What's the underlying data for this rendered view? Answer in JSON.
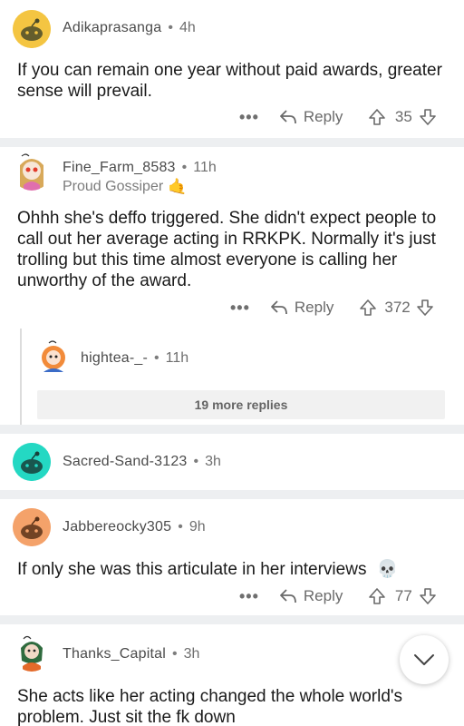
{
  "comments": [
    {
      "user": "Adikaprasanga",
      "time": "4h",
      "body": "If you can remain one year without paid awards, greater sense will prevail.",
      "reply_label": "Reply",
      "score": "35",
      "more_label": "•••"
    },
    {
      "user": "Fine_Farm_8583",
      "time": "11h",
      "flair": "Proud Gossiper",
      "flair_emoji": "🤙",
      "body": "Ohhh she's deffo triggered. She didn't expect people to call out her average acting in RRKPK. Normally it's just trolling but this time almost everyone is calling her unworthy of the award.",
      "reply_label": "Reply",
      "score": "372",
      "more_label": "•••",
      "child": {
        "user": "hightea-_-",
        "time": "11h"
      },
      "more_replies": "19 more replies"
    },
    {
      "user": "Sacred-Sand-3123",
      "time": "3h"
    },
    {
      "user": "Jabbereocky305",
      "time": "9h",
      "body": "If only she was this articulate in her interviews",
      "body_emoji": "💀",
      "reply_label": "Reply",
      "score": "77",
      "more_label": "•••"
    },
    {
      "user": "Thanks_Capital",
      "time": "3h",
      "body": "She acts like her acting changed the whole world's problem. Just sit the fk down"
    }
  ],
  "separator": "•",
  "icons": {
    "reply": "reply-arrow-icon",
    "upvote": "upvote-arrow-icon",
    "downvote": "downvote-arrow-icon",
    "scroll": "chevron-down-icon"
  },
  "colors": {
    "avatar_yellow": "#f4c542",
    "avatar_teal": "#24d8c3",
    "avatar_orange": "#f4a26a",
    "separator_bg": "#edeff1"
  }
}
